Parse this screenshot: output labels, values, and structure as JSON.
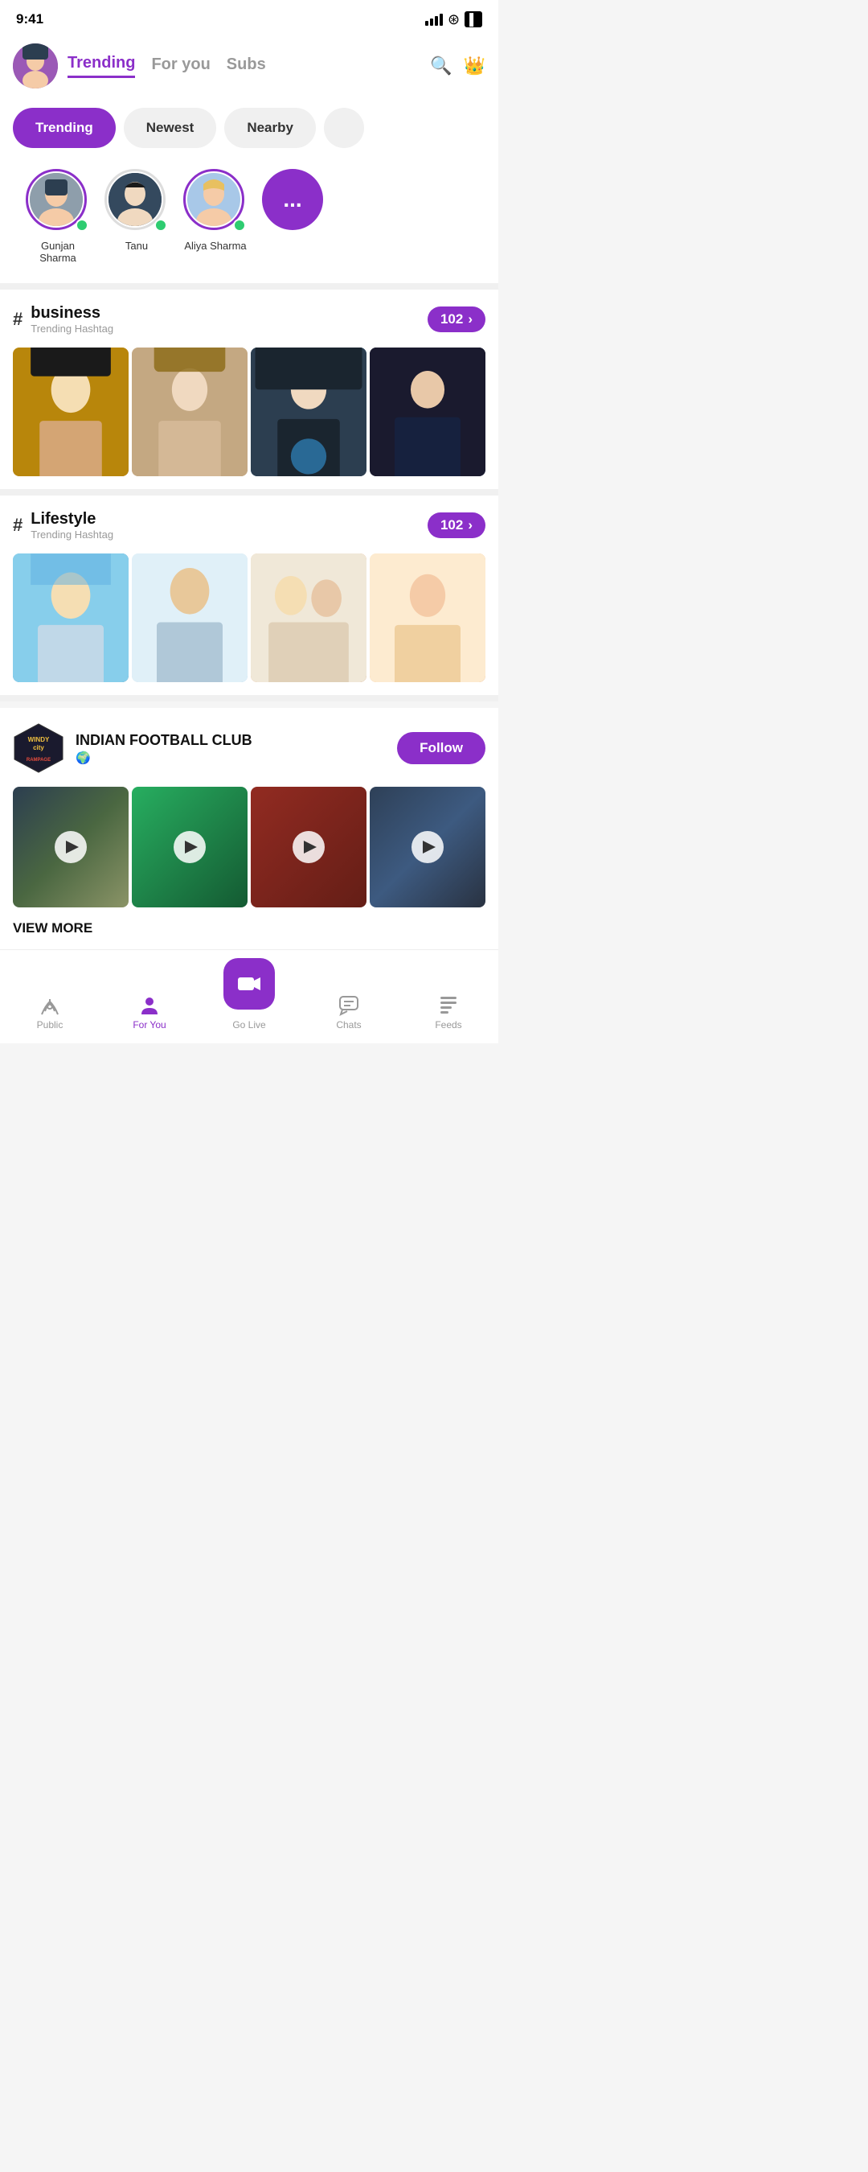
{
  "status": {
    "time": "9:41",
    "signal": [
      4,
      5,
      6,
      7,
      8
    ],
    "wifi": "wifi",
    "battery": "battery"
  },
  "header": {
    "active_tab": "Trending",
    "tabs": [
      "Trending",
      "For you",
      "Subs"
    ],
    "search_icon": "search",
    "crown_icon": "crown"
  },
  "filters": {
    "items": [
      "Trending",
      "Newest",
      "Nearby"
    ],
    "active": "Trending"
  },
  "stories": [
    {
      "name": "Gunjan Sharma",
      "online": true,
      "ring": true
    },
    {
      "name": "Tanu",
      "online": true,
      "ring": false
    },
    {
      "name": "Aliya Sharma",
      "online": true,
      "ring": true
    }
  ],
  "more_label": "...",
  "hashtags": [
    {
      "tag": "business",
      "sub": "Trending Hashtag",
      "count": "102",
      "photos": [
        "photo-1",
        "photo-2",
        "photo-3",
        "photo-4"
      ]
    },
    {
      "tag": "Lifestyle",
      "sub": "Trending Hashtag",
      "count": "102",
      "photos": [
        "photo-1b",
        "photo-2b",
        "photo-3b",
        "photo-4b"
      ]
    }
  ],
  "club": {
    "name": "INDIAN FOOTBALL CLUB",
    "type": "Public",
    "logo_line1": "WINDY",
    "logo_line2": "city",
    "follow_label": "Follow",
    "view_more_label": "VIEW MORE",
    "videos": [
      "video-1",
      "video-2",
      "video-3",
      "video-4"
    ]
  },
  "bottom_nav": {
    "items": [
      {
        "id": "public",
        "label": "Public",
        "icon": "📡"
      },
      {
        "id": "for-you",
        "label": "For You",
        "icon": "👤",
        "active": true
      },
      {
        "id": "go-live",
        "label": "Go Live",
        "icon": "🎥",
        "center": true
      },
      {
        "id": "chats",
        "label": "Chats",
        "icon": "💬"
      },
      {
        "id": "feeds",
        "label": "Feeds",
        "icon": "📋"
      }
    ]
  }
}
